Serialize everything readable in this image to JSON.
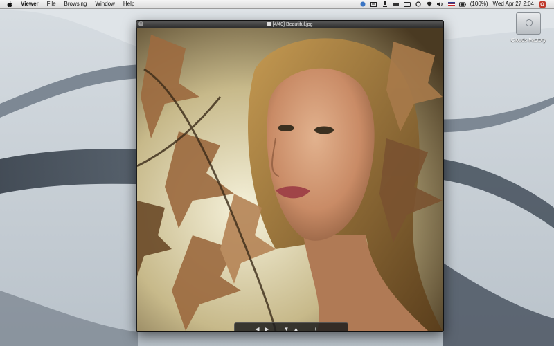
{
  "menubar": {
    "app_name": "Viewer",
    "items": [
      "File",
      "Browsing",
      "Window",
      "Help"
    ],
    "battery": "(100%)",
    "clock": "Wed Apr 27  2:04",
    "icons": [
      "apple-icon",
      "dropbox-icon",
      "notes-icon",
      "flash-icon",
      "drive-icon",
      "display-icon",
      "sync-icon",
      "wifi-icon",
      "volume-icon",
      "flag-icon",
      "battery-icon",
      "search-icon"
    ]
  },
  "desktop": {
    "drive_label": "Clouds Factory"
  },
  "window": {
    "title": "[4/40] Beautiful.jpg",
    "close_glyph": "×"
  },
  "hud": {
    "prev": "◀",
    "next": "▶",
    "down": "▼",
    "up": "▲",
    "zoom_in": "+",
    "zoom_out": "−"
  }
}
